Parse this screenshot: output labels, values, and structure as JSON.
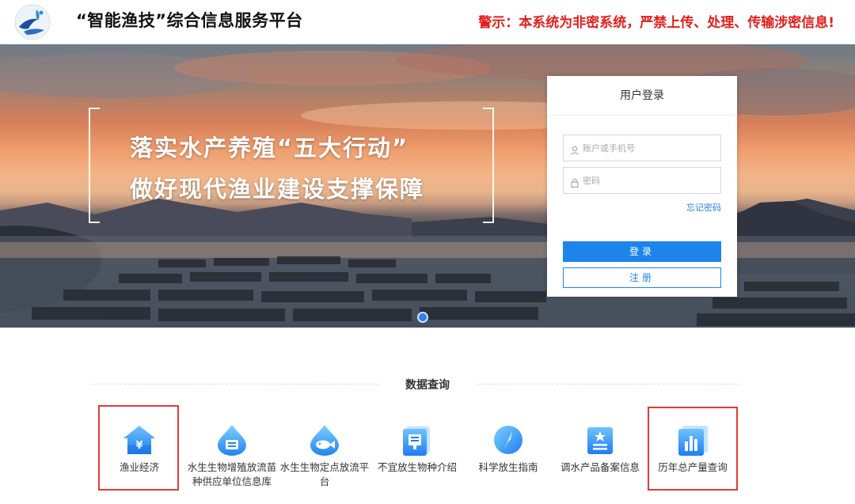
{
  "header": {
    "title": "“智能渔技”综合信息服务平台",
    "warning": "警示：本系统为非密系统，严禁上传、处理、传输涉密信息!"
  },
  "banner": {
    "slogan_line1": "落实水产养殖“五大行动”",
    "slogan_line2": "做好现代渔业建设支撑保障"
  },
  "login": {
    "title": "用户登录",
    "username_placeholder": "账户或手机号",
    "password_placeholder": "密码",
    "forgot_label": "忘记密码",
    "login_label": "登录",
    "register_label": "注册"
  },
  "section": {
    "title": "数据查询",
    "items": [
      {
        "label": "渔业经济",
        "icon": "house-yen-icon"
      },
      {
        "label": "水生生物增殖放流苗种供应单位信息库",
        "icon": "drop-tray-icon"
      },
      {
        "label": "水生生物定点放流平台",
        "icon": "drop-fish-icon"
      },
      {
        "label": "不宜放生物种介绍",
        "icon": "document-icon"
      },
      {
        "label": "科学放生指南",
        "icon": "compass-icon"
      },
      {
        "label": "调水产品备案信息",
        "icon": "star-list-icon"
      },
      {
        "label": "历年总产量查询",
        "icon": "bar-chart-icon"
      }
    ]
  },
  "colors": {
    "accent": "#1d84ec",
    "warning": "#e0201c",
    "highlight": "#e23a36"
  }
}
